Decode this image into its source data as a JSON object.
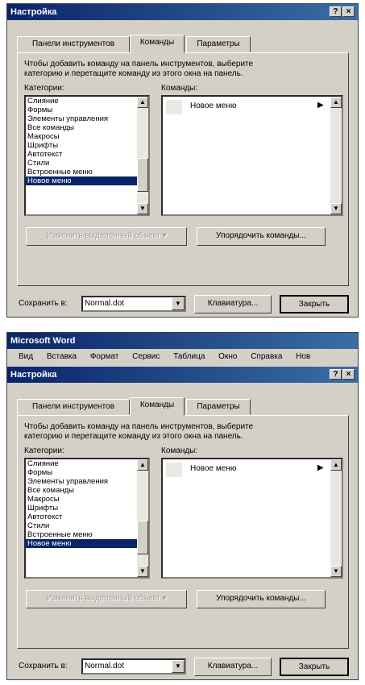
{
  "dialog": {
    "title": "Настройка",
    "help_btn": "?",
    "close_btn": "×",
    "tabs": [
      "Панели инструментов",
      "Команды",
      "Параметры"
    ],
    "description": [
      "Чтобы добавить команду на панель инструментов, выберите",
      "категорию и перетащите команду из этого окна на панель."
    ],
    "categories_label": "Категории:",
    "commands_label": "Команды:",
    "categories": [
      "Слияние",
      "Формы",
      "Элементы управления",
      "Все команды",
      "Макросы",
      "Шрифты",
      "Автотекст",
      "Стили",
      "Встроенные меню",
      "Новое меню"
    ],
    "selected_category": "Новое меню",
    "command_item": "Новое меню",
    "modify_btn": "Изменить выделенный объект ▾",
    "rearrange_btn": "Упорядочить команды...",
    "save_in_label": "Сохранить в:",
    "save_in_value": "Normal.dot",
    "keyboard_btn": "Клавиатура...",
    "close_button": "Закрыть"
  },
  "word": {
    "app_title": "Microsoft Word",
    "menu": [
      "Вид",
      "Вставка",
      "Формат",
      "Сервис",
      "Таблица",
      "Окно",
      "Справка",
      "Нов"
    ]
  },
  "icons": {
    "dropdown": "▼",
    "scroll_up": "▲",
    "scroll_down": "▼",
    "submenu_arrow": "▶"
  }
}
